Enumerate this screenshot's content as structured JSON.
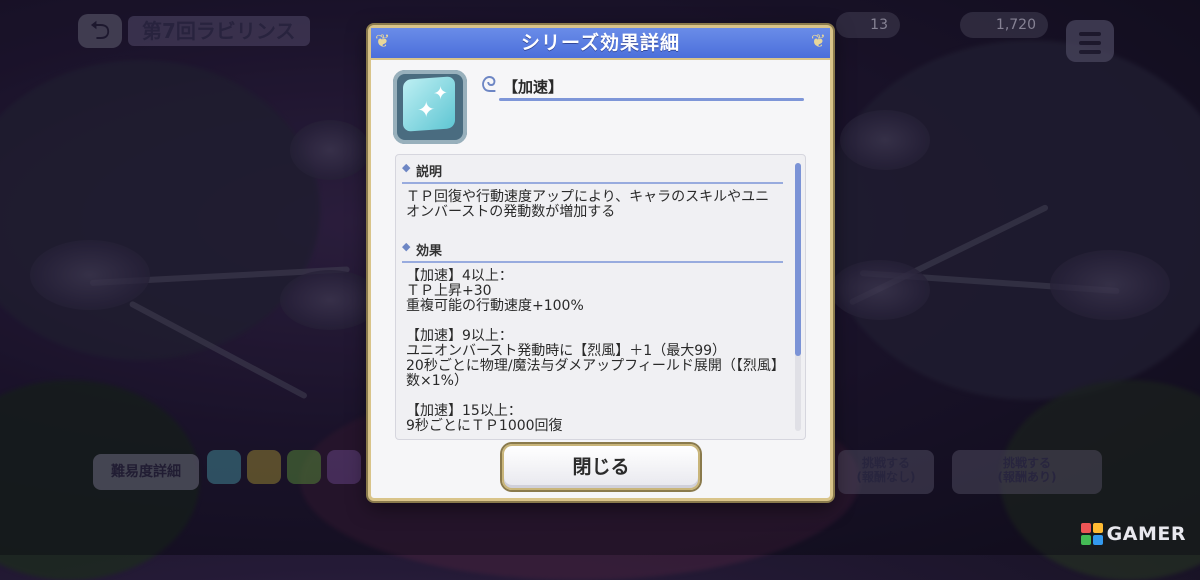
{
  "background": {
    "back_arrow": "⮌",
    "stage_title": "第7回ラビリンス",
    "stat_1": "13",
    "stat_2": "1,720",
    "difficulty_button": "難易度詳細",
    "right_button_1": "挑戦する\n(報酬なし)",
    "right_button_2": "挑戦する\n(報酬あり)"
  },
  "watermark": {
    "text": "GAMER"
  },
  "modal": {
    "title": "シリーズ効果詳細",
    "effect_name": "【加速】",
    "sections": [
      {
        "heading": "説明",
        "text": "ＴＰ回復や行動速度アップにより、キャラのスキルやユニオンバーストの発動数が増加する"
      },
      {
        "heading": "効果",
        "text": "【加速】4以上：\nＴＰ上昇+30\n重複可能の行動速度+100%\n\n【加速】9以上：\nユニオンバースト発動時に【烈風】＋1（最大99）\n20秒ごとに物理/魔法与ダメアップフィールド展開（【烈風】数×1%）\n\n【加速】15以上：\n9秒ごとにＴＰ1000回復"
      }
    ],
    "close_label": "閉じる"
  },
  "colors": {
    "header_blue": "#4b6fdb",
    "frame_gold": "#d9c48a",
    "accent_line": "#7e96d8"
  }
}
